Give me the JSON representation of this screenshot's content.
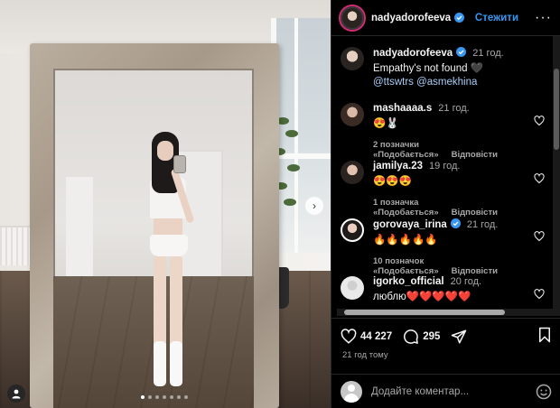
{
  "post": {
    "username": "nadyadorofeeva",
    "follow_label": "Стежити",
    "more_label": "···",
    "caption": {
      "username": "nadyadorofeeva",
      "time": "21 год.",
      "text": "Empathy's not found 🖤",
      "mentions": "@ttswtrs @asmekhina"
    },
    "likes": "44 227",
    "comments_count": "295",
    "posted_ago": "21 год тому",
    "carousel": {
      "count": 7,
      "active": 0
    }
  },
  "comments": [
    {
      "username": "mashaaaa.s",
      "time": "21 год.",
      "text": "😍🐰",
      "likes_label": "2 позначки «Подобається»",
      "reply_label": "Відповісти"
    },
    {
      "username": "jamilya.23",
      "time": "19 год.",
      "text": "😍😍😍",
      "likes_label": "1 позначка «Подобається»",
      "reply_label": "Відповісти"
    },
    {
      "username": "gorovaya_irina",
      "time": "21 год.",
      "text": "🔥🔥🔥🔥🔥",
      "likes_label": "10 позначок «Подобається»",
      "reply_label": "Відповісти",
      "verified": true
    },
    {
      "username": "igorko_official",
      "time": "20 год.",
      "text": "люблю❤️❤️❤️❤️❤️",
      "likes_label": "",
      "reply_label": ""
    }
  ],
  "composer": {
    "placeholder": "Додайте коментар..."
  },
  "colors": {
    "background": "#000000",
    "accent": "#3897f0",
    "secondary_text": "#a8a8a8",
    "divider": "#262626"
  }
}
